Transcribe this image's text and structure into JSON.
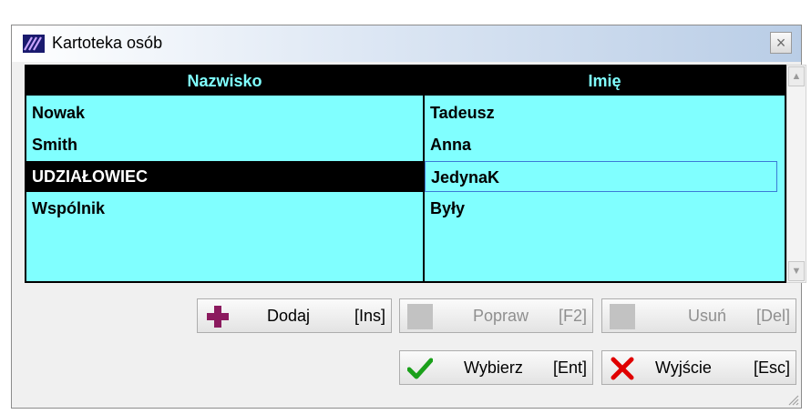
{
  "window": {
    "title": "Kartoteka osób",
    "close_glyph": "×"
  },
  "table": {
    "headers": [
      "Nazwisko",
      "Imię"
    ],
    "rows": [
      [
        "Nowak",
        "Tadeusz"
      ],
      [
        "Smith",
        "Anna"
      ],
      [
        "UDZIAŁOWIEC",
        "JedynaK"
      ],
      [
        "Wspólnik",
        "Były"
      ]
    ],
    "selected_row": 2,
    "header_color": "#000000",
    "header_text_color": "#80ffff",
    "row_background": "#80ffff"
  },
  "buttons": {
    "add": {
      "label": "Dodaj",
      "key": "[Ins]",
      "icon": "plus-icon",
      "enabled": true
    },
    "edit": {
      "label": "Popraw",
      "key": "[F2]",
      "icon": "blank-icon",
      "enabled": false
    },
    "delete": {
      "label": "Usuń",
      "key": "[Del]",
      "icon": "blank-icon",
      "enabled": false
    },
    "select": {
      "label": "Wybierz",
      "key": "[Ent]",
      "icon": "checkmark-icon",
      "enabled": true
    },
    "exit": {
      "label": "Wyjście",
      "key": "[Esc]",
      "icon": "x-icon",
      "enabled": true
    }
  },
  "colors": {
    "add_plus": "#8b1a5e",
    "check": "#1aa01a",
    "x": "#e00000"
  }
}
